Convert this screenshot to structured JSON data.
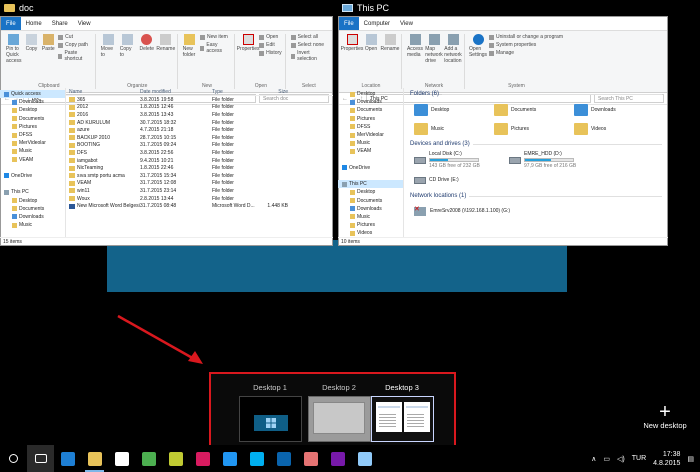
{
  "left_window": {
    "title": "doc",
    "tabs": [
      "File",
      "Home",
      "Share",
      "View"
    ],
    "ribbon": {
      "pin_label": "Pin to Quick access",
      "copy_label": "Copy",
      "paste_label": "Paste",
      "cut": "Cut",
      "copy_path": "Copy path",
      "paste_shortcut": "Paste shortcut",
      "clipboard_group": "Clipboard",
      "move_to": "Move to",
      "copy_to": "Copy to",
      "delete": "Delete",
      "rename": "Rename",
      "organize_group": "Organize",
      "new_folder": "New folder",
      "new_item": "New item",
      "easy_access": "Easy access",
      "new_group": "New",
      "properties": "Properties",
      "open": "Open",
      "edit": "Edit",
      "history": "History",
      "open_group": "Open",
      "select_all": "Select all",
      "select_none": "Select none",
      "invert_selection": "Invert selection",
      "select_group": "Select"
    },
    "address": "doc",
    "search_placeholder": "Search doc",
    "nav": [
      {
        "label": "Quick access",
        "sel": true,
        "ind": false
      },
      {
        "label": "Downloads",
        "sel": false,
        "ind": true
      },
      {
        "label": "Desktop",
        "sel": false,
        "ind": true
      },
      {
        "label": "Documents",
        "sel": false,
        "ind": true
      },
      {
        "label": "Pictures",
        "sel": false,
        "ind": true
      },
      {
        "label": "DFSS",
        "sel": false,
        "ind": true
      },
      {
        "label": "MerVideolar",
        "sel": false,
        "ind": true
      },
      {
        "label": "Music",
        "sel": false,
        "ind": true
      },
      {
        "label": "VEAM",
        "sel": false,
        "ind": true
      },
      {
        "label": "",
        "sel": false,
        "ind": false
      },
      {
        "label": "OneDrive",
        "sel": false,
        "ind": false
      },
      {
        "label": "",
        "sel": false,
        "ind": false
      },
      {
        "label": "This PC",
        "sel": false,
        "ind": false
      },
      {
        "label": "Desktop",
        "sel": false,
        "ind": true
      },
      {
        "label": "Documents",
        "sel": false,
        "ind": true
      },
      {
        "label": "Downloads",
        "sel": false,
        "ind": true
      },
      {
        "label": "Music",
        "sel": false,
        "ind": true
      }
    ],
    "columns": [
      "Name",
      "Date modified",
      "Type",
      "Size"
    ],
    "rows": [
      {
        "name": "365",
        "date": "3.8.2015 19:58",
        "type": "File folder",
        "size": "",
        "doc": false
      },
      {
        "name": "2012",
        "date": "1.8.2015 12:46",
        "type": "File folder",
        "size": "",
        "doc": false
      },
      {
        "name": "2016",
        "date": "3.8.2015 13:43",
        "type": "File folder",
        "size": "",
        "doc": false
      },
      {
        "name": "AD KURULUM",
        "date": "30.7.2015 18:32",
        "type": "File folder",
        "size": "",
        "doc": false
      },
      {
        "name": "azure",
        "date": "4.7.2015 21:18",
        "type": "File folder",
        "size": "",
        "doc": false
      },
      {
        "name": "BACKUP 2010",
        "date": "28.7.2015 10:15",
        "type": "File folder",
        "size": "",
        "doc": false
      },
      {
        "name": "BOOTING",
        "date": "31.7.2015 09:24",
        "type": "File folder",
        "size": "",
        "doc": false
      },
      {
        "name": "DFS",
        "date": "3.8.2015 22:56",
        "type": "File folder",
        "size": "",
        "doc": false
      },
      {
        "name": "iamgabot",
        "date": "9.4.2015 10:21",
        "type": "File folder",
        "size": "",
        "doc": false
      },
      {
        "name": "NicTeaming",
        "date": "1.8.2015 22:46",
        "type": "File folder",
        "size": "",
        "doc": false
      },
      {
        "name": "sıva smtp portu acma",
        "date": "31.7.2015 15:34",
        "type": "File folder",
        "size": "",
        "doc": false
      },
      {
        "name": "VEAM",
        "date": "31.7.2015 12:08",
        "type": "File folder",
        "size": "",
        "doc": false
      },
      {
        "name": "win11",
        "date": "31.7.2015 23:14",
        "type": "File folder",
        "size": "",
        "doc": false
      },
      {
        "name": "Woux",
        "date": "2.8.2015 13:44",
        "type": "File folder",
        "size": "",
        "doc": false
      },
      {
        "name": "New Microsoft Word Belgesi.docx",
        "date": "31.7.2015 08:48",
        "type": "Microsoft Word D...",
        "size": "1.448 KB",
        "doc": true
      }
    ],
    "status": "15 items"
  },
  "right_window": {
    "title": "This PC",
    "tabs": [
      "File",
      "Computer",
      "View"
    ],
    "ribbon": {
      "properties": "Properties",
      "open": "Open",
      "rename": "Rename",
      "location_group": "Location",
      "access_media": "Access media",
      "map_drive": "Map network drive",
      "add_location": "Add a network location",
      "network_group": "Network",
      "open_settings": "Open Settings",
      "uninstall": "Uninstall or change a program",
      "sys_props": "System properties",
      "manage": "Manage",
      "system_group": "System"
    },
    "address": "This PC",
    "search_placeholder": "Search This PC",
    "nav": [
      {
        "label": "Desktop",
        "sel": false,
        "ind": true
      },
      {
        "label": "Downloads",
        "sel": false,
        "ind": true
      },
      {
        "label": "Documents",
        "sel": false,
        "ind": true
      },
      {
        "label": "Pictures",
        "sel": false,
        "ind": true
      },
      {
        "label": "DFSS",
        "sel": false,
        "ind": true
      },
      {
        "label": "MerVideolar",
        "sel": false,
        "ind": true
      },
      {
        "label": "Music",
        "sel": false,
        "ind": true
      },
      {
        "label": "VEAM",
        "sel": false,
        "ind": true
      },
      {
        "label": "",
        "sel": false,
        "ind": false
      },
      {
        "label": "OneDrive",
        "sel": false,
        "ind": false
      },
      {
        "label": "",
        "sel": false,
        "ind": false
      },
      {
        "label": "This PC",
        "sel": true,
        "ind": false
      },
      {
        "label": "Desktop",
        "sel": false,
        "ind": true
      },
      {
        "label": "Documents",
        "sel": false,
        "ind": true
      },
      {
        "label": "Downloads",
        "sel": false,
        "ind": true
      },
      {
        "label": "Music",
        "sel": false,
        "ind": true
      },
      {
        "label": "Pictures",
        "sel": false,
        "ind": true
      },
      {
        "label": "Videos",
        "sel": false,
        "ind": true
      },
      {
        "label": "Local Disk (C:)",
        "sel": false,
        "ind": true
      },
      {
        "label": "EMRE_HDD (D:)",
        "sel": false,
        "ind": true
      },
      {
        "label": "CD Drive (E:)",
        "sel": false,
        "ind": true
      },
      {
        "label": "EmreSrv2008 (\\\\192.168.1.100) (G:)",
        "sel": false,
        "ind": true
      },
      {
        "label": "Network",
        "sel": false,
        "ind": false
      }
    ],
    "folders_heading": "Folders (6)",
    "folders": [
      "Desktop",
      "Documents",
      "Downloads",
      "Music",
      "Pictures",
      "Videos"
    ],
    "drives_heading": "Devices and drives (3)",
    "drives": [
      {
        "name": "Local Disk (C:)",
        "free": "143 GB free of 232 GB",
        "used": 0.38
      },
      {
        "name": "EMRE_HDD (D:)",
        "free": "97,9 GB free of 216 GB",
        "used": 0.55
      },
      {
        "name": "CD Drive (E:)",
        "free": "",
        "used": 0
      }
    ],
    "network_heading": "Network locations (1)",
    "network_item": "EmreSrv2008 (\\\\192.168.1.100) (G:)",
    "status": "10 items"
  },
  "switcher": {
    "desktops": [
      {
        "label": "Desktop 1"
      },
      {
        "label": "Desktop 2"
      },
      {
        "label": "Desktop 3"
      }
    ]
  },
  "new_desktop_label": "New desktop",
  "taskbar": {
    "apps": [
      {
        "name": "search-icon",
        "color": "#000000"
      },
      {
        "name": "task-view-icon",
        "color": "#555555"
      },
      {
        "name": "edge-icon",
        "color": "#1e7fd4"
      },
      {
        "name": "file-explorer-icon",
        "color": "#e8c35a"
      },
      {
        "name": "store-icon",
        "color": "#ffffff"
      },
      {
        "name": "chrome-icon",
        "color": "#4caf50"
      },
      {
        "name": "app-icon",
        "color": "#c0ca33"
      },
      {
        "name": "paint-icon",
        "color": "#d81b60"
      },
      {
        "name": "app-icon",
        "color": "#2196f3"
      },
      {
        "name": "skype-icon",
        "color": "#00aff0"
      },
      {
        "name": "outlook-icon",
        "color": "#0a64ad"
      },
      {
        "name": "app-icon",
        "color": "#e57373"
      },
      {
        "name": "onenote-icon",
        "color": "#7719aa"
      },
      {
        "name": "app-icon",
        "color": "#90caf9"
      }
    ],
    "lang": "TUR",
    "time": "17:38",
    "date": "4.8.2015"
  }
}
